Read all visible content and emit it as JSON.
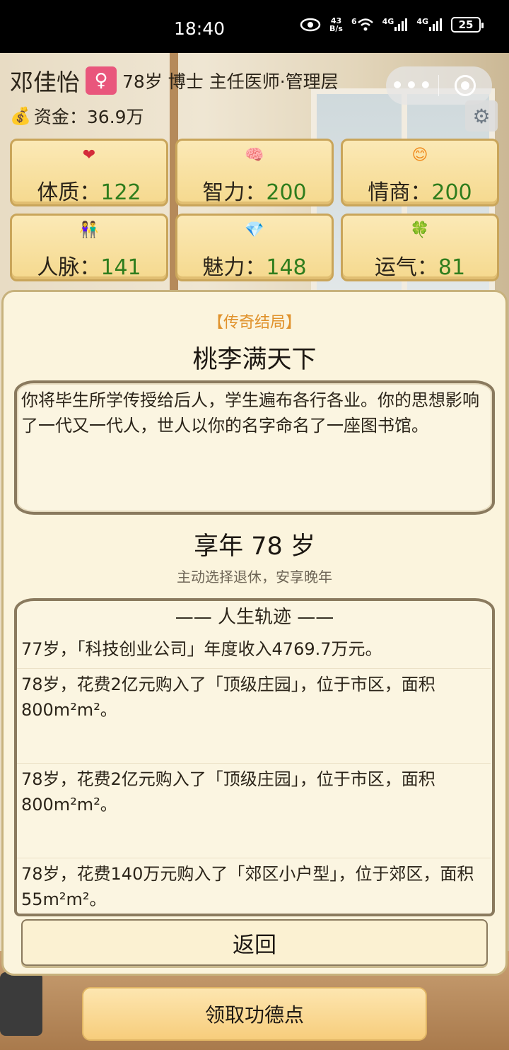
{
  "status_bar": {
    "time": "18:40",
    "net_speed_top": "43",
    "net_speed_bottom": "B/s",
    "battery": "25",
    "net_label_1": "4G",
    "net_label_2": "4G",
    "wifi_badge": "6"
  },
  "player": {
    "name": "邓佳怡",
    "gender_symbol": "♀",
    "profile": "78岁 博士 主任医师·管理层",
    "money": "资金：36.9万"
  },
  "stats": [
    {
      "icon": "❤",
      "icon_name": "heart-icon",
      "color": "#d42b3a",
      "label": "体质：",
      "value": "122"
    },
    {
      "icon": "🧠",
      "icon_name": "brain-icon",
      "color": "#3b7bd8",
      "label": "智力：",
      "value": "200"
    },
    {
      "icon": "😊",
      "icon_name": "smile-icon",
      "color": "#f08a1c",
      "label": "情商：",
      "value": "200"
    },
    {
      "icon": "👫",
      "icon_name": "people-icon",
      "color": "#2f8a3a",
      "label": "人脉：",
      "value": "141"
    },
    {
      "icon": "💎",
      "icon_name": "diamond-icon",
      "color": "#7a3bb8",
      "label": "魅力：",
      "value": "148"
    },
    {
      "icon": "🍀",
      "icon_name": "clover-icon",
      "color": "#b99a2c",
      "label": "运气：",
      "value": "81"
    }
  ],
  "ending": {
    "tag": "【传奇结局】",
    "title": "桃李满天下",
    "description": "你将毕生所学传授给后人，学生遍布各行各业。你的思想影响了一代又一代人，世人以你的名字命名了一座图书馆。",
    "age": "享年 78 岁",
    "reason": "主动选择退休，安享晚年"
  },
  "track": {
    "title": "—— 人生轨迹 ——",
    "entries": [
      "77岁，「科技创业公司」年度收入4769.7万元。",
      "78岁，花费2亿元购入了「顶级庄园」，位于市区，面积800m²m²。",
      "78岁，花费2亿元购入了「顶级庄园」，位于市区，面积800m²m²。",
      "78岁，花费140万元购入了「郊区小户型」，位于郊区，面积55m²m²。"
    ]
  },
  "buttons": {
    "back": "返回",
    "merit": "领取功德点"
  },
  "colors": {
    "stat_value": "#2f7d1d",
    "tag": "#e0922c",
    "gender_badge": "#e9567c"
  }
}
